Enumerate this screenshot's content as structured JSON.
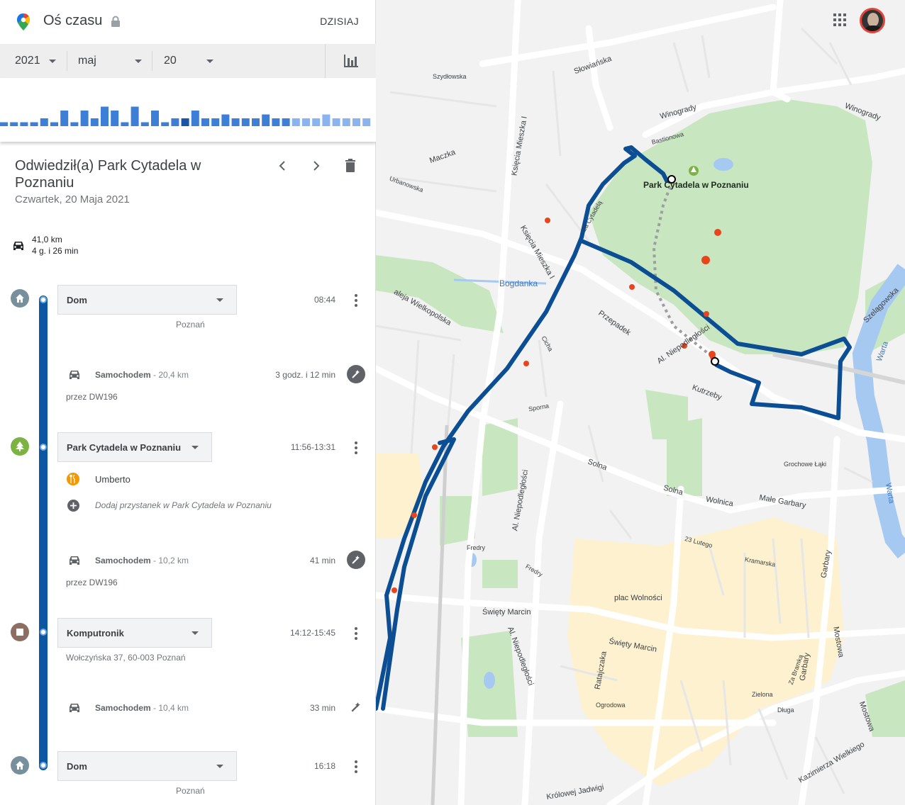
{
  "header": {
    "title": "Oś czasu",
    "today_label": "DZISIAJ"
  },
  "date_selector": {
    "year": "2021",
    "month": "maj",
    "day": "20"
  },
  "activity_histogram": [
    1,
    1,
    1,
    1,
    2,
    1,
    4,
    1,
    4,
    2,
    5,
    4,
    1,
    5,
    1,
    4,
    1,
    2,
    2,
    4,
    2,
    2,
    3,
    2,
    2,
    2,
    3,
    2,
    2,
    2,
    2,
    2,
    3,
    2,
    2,
    2,
    2
  ],
  "activity_highlight_index": 18,
  "detail": {
    "title": "Odwiedził(a) Park Cytadela w Poznaniu",
    "date": "Czwartek, 20 Maja 2021",
    "distance": "41,0 km",
    "duration": "4 g. i 26 min"
  },
  "timeline": {
    "places": [
      {
        "name": "Dom",
        "time": "08:44",
        "sub": "Poznań"
      },
      {
        "name": "Park Cytadela w Poznaniu",
        "time": "11:56-13:31",
        "stop": "Umberto",
        "add_stop": "Dodaj przystanek w Park Cytadela w Poznaniu"
      },
      {
        "name": "Komputronik",
        "time": "14:12-15:45",
        "sub": "Wołczyńska 37, 60-003 Poznań"
      },
      {
        "name": "Dom",
        "time": "16:18",
        "sub": "Poznań"
      }
    ],
    "moves": [
      {
        "mode": "Samochodem",
        "distance": " - 20,4 km",
        "duration": "3 godz. i 12 min",
        "via": "przez DW196"
      },
      {
        "mode": "Samochodem",
        "distance": " - 10,2 km",
        "duration": "41 min",
        "via": "przez DW196"
      },
      {
        "mode": "Samochodem",
        "distance": " - 10,4 km",
        "duration": "33 min"
      }
    ]
  },
  "map": {
    "place_label": "Park Cytadela w Poznaniu",
    "route_color": "#0b4e93",
    "labels": [
      "Słowiańska",
      "Winogrady",
      "Winogrady",
      "Bastionowa",
      "Za Cytadelą",
      "Księcia Mieszka I",
      "Księcia Mieszka I",
      "Bogdanka",
      "aleja Wielkopolska",
      "Przepadek",
      "Al. Niepodległości",
      "Kutrzeby",
      "Solna",
      "Solna",
      "Wolnica",
      "Małe Garbary",
      "Święty Marcin",
      "Święty Marcin",
      "plac Wolności",
      "Garbary",
      "Mostowa",
      "Warta",
      "Warta",
      "Ratajczaka",
      "Al. Niepodległości",
      "Al. Niepodległości",
      "Grochowe Łąki",
      "Kazimierza Wielkiego",
      "Szelągowska",
      "Maczka",
      "23 Lutego",
      "Ogrodowa",
      "Długa",
      "Zielona",
      "Szydłowska",
      "Urbanowska",
      "Sporna",
      "Cicha",
      "Garbary",
      "Mostowa",
      "Królowej Jadwigi",
      "Fredry",
      "Fredry",
      "Za Bramką",
      "Kramarska"
    ]
  }
}
